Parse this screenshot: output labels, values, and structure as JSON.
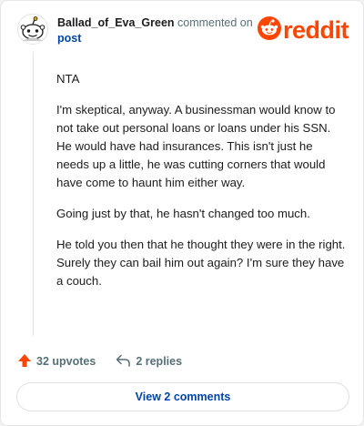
{
  "comment": {
    "author": "Ballad_of_Eva_Green",
    "commented_on": "commented on",
    "post_link": "post",
    "paragraphs": [
      "NTA",
      "I'm skeptical, anyway. A businessman would know to not take out personal loans or loans under his SSN. He would have had insurances. This isn't just he needs up a little, he was cutting corners that would have come to haunt him either way.",
      "Going just by that, he hasn't changed too much.",
      "He told you then that he thought they were in the right. Surely they can bail him out again? I'm sure they have a couch."
    ]
  },
  "brand": {
    "name": "reddit",
    "color": "#ff4500"
  },
  "actions": {
    "upvotes": "32 upvotes",
    "replies": "2 replies"
  },
  "footer": {
    "view_comments": "View 2 comments"
  },
  "icons": {
    "avatar": "snoo-avatar-icon",
    "logo": "reddit-logo-icon",
    "upvote": "upvote-arrow-icon",
    "reply": "reply-arrow-icon"
  }
}
